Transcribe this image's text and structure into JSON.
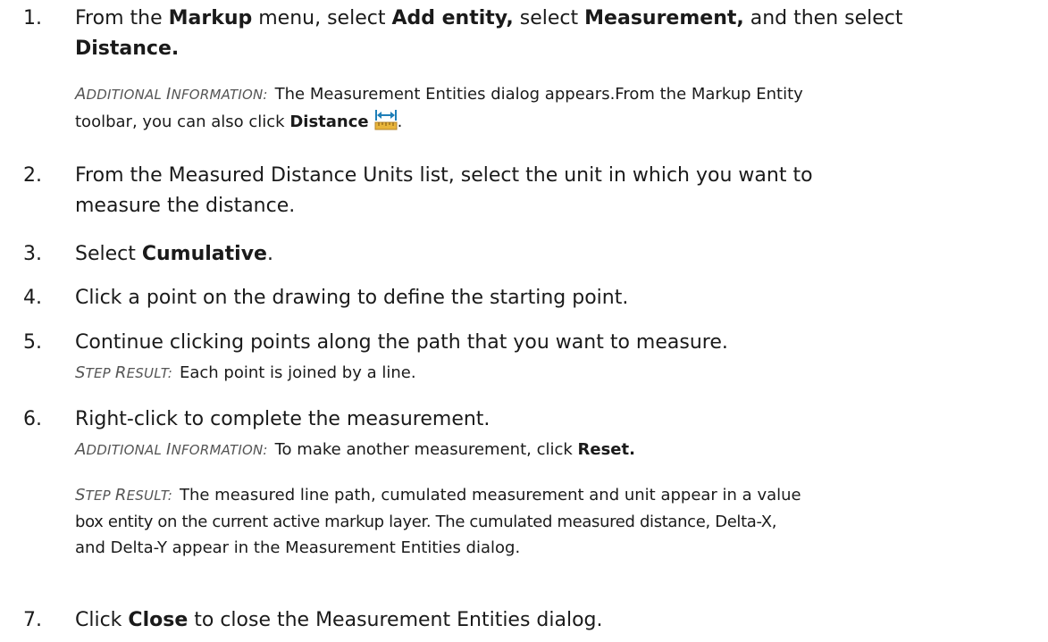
{
  "steps": [
    {
      "num": "1.",
      "parts": [
        "From the ",
        "Markup",
        " menu, select ",
        "Add entity,",
        " select ",
        "Measurement,",
        " and then select"
      ],
      "line2": "Distance.",
      "note": {
        "label_first": "A",
        "label_rest": "DDITIONAL ",
        "label_first2": "I",
        "label_rest2": "NFORMATION:",
        "text": "The Measurement Entities dialog appears.From the Markup Entity",
        "text2": "toolbar, you can also click ",
        "bold": "Distance",
        "tail": "."
      }
    },
    {
      "num": "2.",
      "line1": "From the Measured Distance Units list, select the unit in which you want to",
      "line2": "measure the distance."
    },
    {
      "num": "3.",
      "pre": "Select ",
      "bold": "Cumulative",
      "post": "."
    },
    {
      "num": "4.",
      "text": "Click a point on the drawing to define the starting point."
    },
    {
      "num": "5.",
      "text": "Continue clicking points along the path that you want to measure.",
      "note": {
        "label_first": "S",
        "label_rest": "TEP ",
        "label_first2": "R",
        "label_rest2": "ESULT:",
        "text": "Each point is joined by a line."
      }
    },
    {
      "num": "6.",
      "text": "Right-click to complete the measurement.",
      "note1": {
        "label_first": "A",
        "label_rest": "DDITIONAL ",
        "label_first2": "I",
        "label_rest2": "NFORMATION:",
        "text": "To make another measurement, click ",
        "bold": "Reset."
      },
      "note2": {
        "label_first": "S",
        "label_rest": "TEP ",
        "label_first2": "R",
        "label_rest2": "ESULT:",
        "line1": "The measured line path, cumulated measurement and unit appear in a value",
        "line2": "box entity on the current active markup layer. The cumulated measured distance, Delta-X,",
        "line3": "and Delta-Y appear in the Measurement Entities dialog."
      }
    },
    {
      "num": "7.",
      "pre": "Click ",
      "bold": "Close",
      "post": " to close the Measurement Entities dialog."
    }
  ],
  "icons": {
    "distance": "distance-ruler-icon"
  },
  "colors": {
    "text": "#1a1a1a",
    "label": "#555555",
    "icon_ruler": "#e8b53c",
    "icon_arrow": "#1f7fb8"
  }
}
